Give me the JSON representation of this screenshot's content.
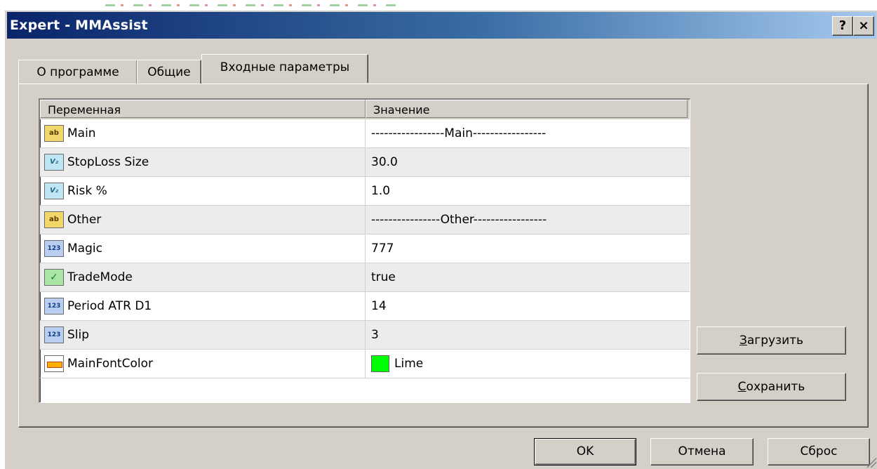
{
  "window": {
    "title": "Expert - MMAssist",
    "help_label": "?",
    "close_label": "×"
  },
  "tabs": [
    {
      "label": "О программе"
    },
    {
      "label": "Общие"
    },
    {
      "label": "Входные параметры",
      "active": true
    }
  ],
  "grid": {
    "columns": [
      "Переменная",
      "Значение"
    ],
    "rows": [
      {
        "icon": "string-type-icon",
        "icon_text": "ab",
        "name": "Main",
        "value": "-----------------Main-----------------"
      },
      {
        "icon": "double-type-icon",
        "icon_text": "V₂",
        "name": "StopLoss Size",
        "value": "30.0"
      },
      {
        "icon": "double-type-icon",
        "icon_text": "V₂",
        "name": "Risk %",
        "value": "1.0"
      },
      {
        "icon": "string-type-icon",
        "icon_text": "ab",
        "name": "Other",
        "value": "----------------Other-----------------"
      },
      {
        "icon": "integer-type-icon",
        "icon_text": "123",
        "name": "Magic",
        "value": "777"
      },
      {
        "icon": "bool-type-icon",
        "icon_text": "✓",
        "name": "TradeMode",
        "value": "true"
      },
      {
        "icon": "integer-type-icon",
        "icon_text": "123",
        "name": "Period ATR D1",
        "value": "14"
      },
      {
        "icon": "integer-type-icon",
        "icon_text": "123",
        "name": "Slip",
        "value": "3"
      },
      {
        "icon": "color-type-icon",
        "icon_text": "",
        "name": "MainFontColor",
        "value": "Lime",
        "swatch": "#00ff00"
      }
    ]
  },
  "side_buttons": {
    "load_prefix": "З",
    "load_rest": "агрузить",
    "save_prefix": "С",
    "save_rest": "охранить"
  },
  "bottom_buttons": {
    "ok": "OK",
    "cancel": "Отмена",
    "reset": "Сброс"
  },
  "colors": {
    "title_gradient_start": "#0a246a",
    "title_gradient_end": "#a6caf0",
    "face": "#d4d0c8",
    "lime": "#00ff00"
  }
}
